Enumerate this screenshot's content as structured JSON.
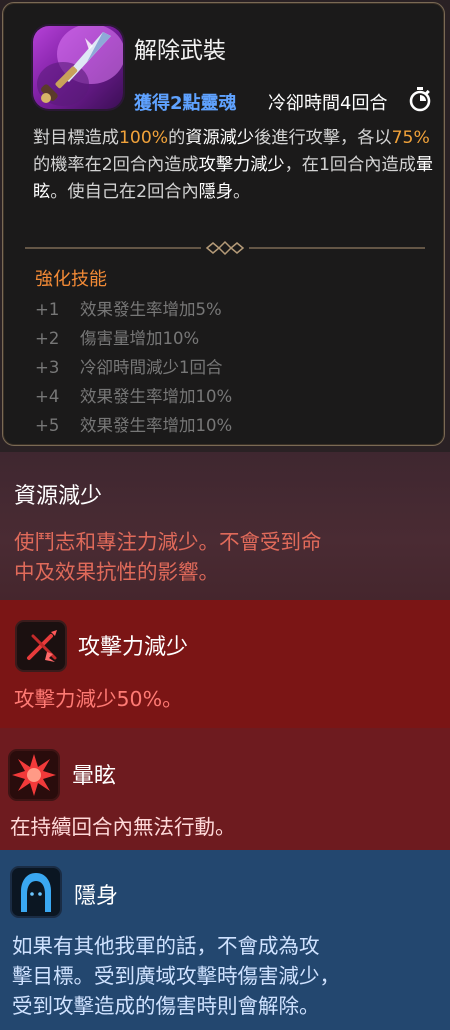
{
  "skill": {
    "name": "解除武裝",
    "soul_gain": "獲得2點靈魂",
    "cooldown": "冷卻時間4回合",
    "description": {
      "p1": "對目標造成",
      "p2": "100%",
      "p3": "的",
      "p4": "資源減少",
      "p5": "後進行攻擊，各以",
      "p6": "75%",
      "p7": "的機率在2回合內造成",
      "p8": "攻擊力減少",
      "p9": "，在1回合內造成",
      "p10": "暈眩",
      "p11": "。使自己在2回合內",
      "p12": "隱身",
      "p13": "。"
    }
  },
  "enhance": {
    "title": "強化技能",
    "items": [
      {
        "level": "+1",
        "text": "效果發生率增加5%"
      },
      {
        "level": "+2",
        "text": "傷害量增加10%"
      },
      {
        "level": "+3",
        "text": "冷卻時間減少1回合"
      },
      {
        "level": "+4",
        "text": "效果發生率增加10%"
      },
      {
        "level": "+5",
        "text": "效果發生率增加10%"
      }
    ]
  },
  "effects": {
    "resource": {
      "title": "資源減少",
      "desc_line1": "使鬥志和專注力減少。不會受到命",
      "desc_line2": "中及效果抗性的影響。"
    },
    "attack_down": {
      "title": "攻擊力減少",
      "desc": "攻擊力減少50%。"
    },
    "stun": {
      "title": "暈眩",
      "desc": "在持續回合內無法行動。"
    },
    "stealth": {
      "title": "隱身",
      "desc_line1": "如果有其他我軍的話，不會成為攻",
      "desc_line2": "擊目標。受到廣域攻擊時傷害減少，",
      "desc_line3": "受到攻擊造成的傷害時則會解除。"
    }
  },
  "icons": {
    "skill": "sword-skill-icon",
    "timer": "stopwatch-icon",
    "attack_down": "broken-sword-icon",
    "stun": "starburst-icon",
    "stealth": "hooded-figure-icon"
  },
  "colors": {
    "highlight": "#f1a23a",
    "soul": "#5fa2ff",
    "enhance_title": "#f28a36",
    "resource_text": "#e06a5a",
    "attack_down_text": "#ff7a74",
    "stun_text": "#ffd9d9",
    "stealth_text": "#cfe2ff"
  }
}
